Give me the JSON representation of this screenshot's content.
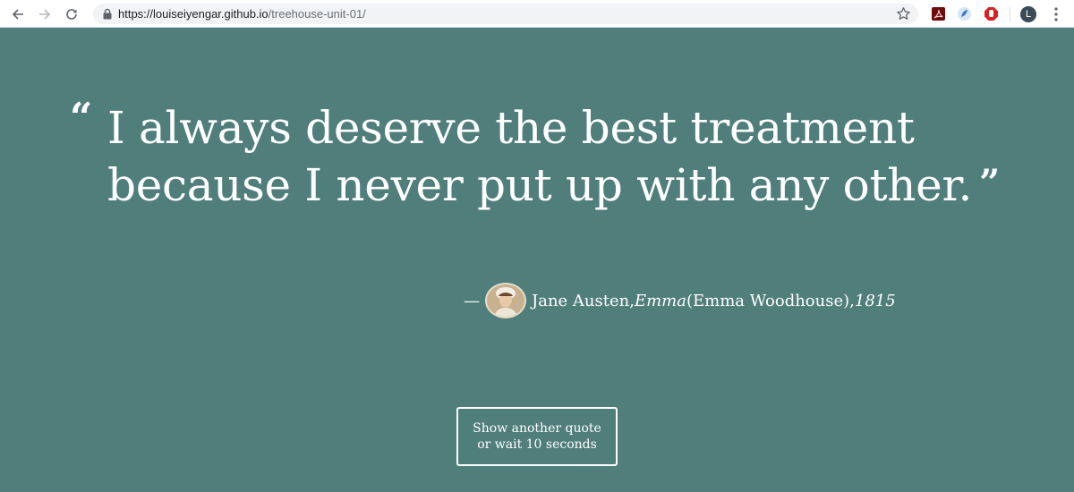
{
  "browser": {
    "url_host": "https://louiseiyengar.github.io",
    "url_path": "/treehouse-unit-01/",
    "profile_initial": "L",
    "icons": {
      "back": "arrow-left-icon",
      "forward": "arrow-right-icon",
      "reload": "reload-icon",
      "lock": "lock-icon",
      "bookmark": "star-icon",
      "extensions": [
        "adobe-pdf-icon",
        "blue-extension-icon",
        "adblock-stop-icon"
      ],
      "menu": "three-dots-menu-icon"
    }
  },
  "page": {
    "background_color": "#4f7e7b",
    "quote_open_mark": "“",
    "quote_text": "I always deserve the best treatment because I never put up with any other.",
    "quote_close_mark": "”",
    "attribution": {
      "dash": "—",
      "author": "Jane Austen",
      "separator": ", ",
      "work": "Emma",
      "character": " (Emma Woodhouse), ",
      "year": "1815"
    },
    "button": {
      "line1": "Show another quote",
      "line2": "or wait 10 seconds"
    }
  }
}
